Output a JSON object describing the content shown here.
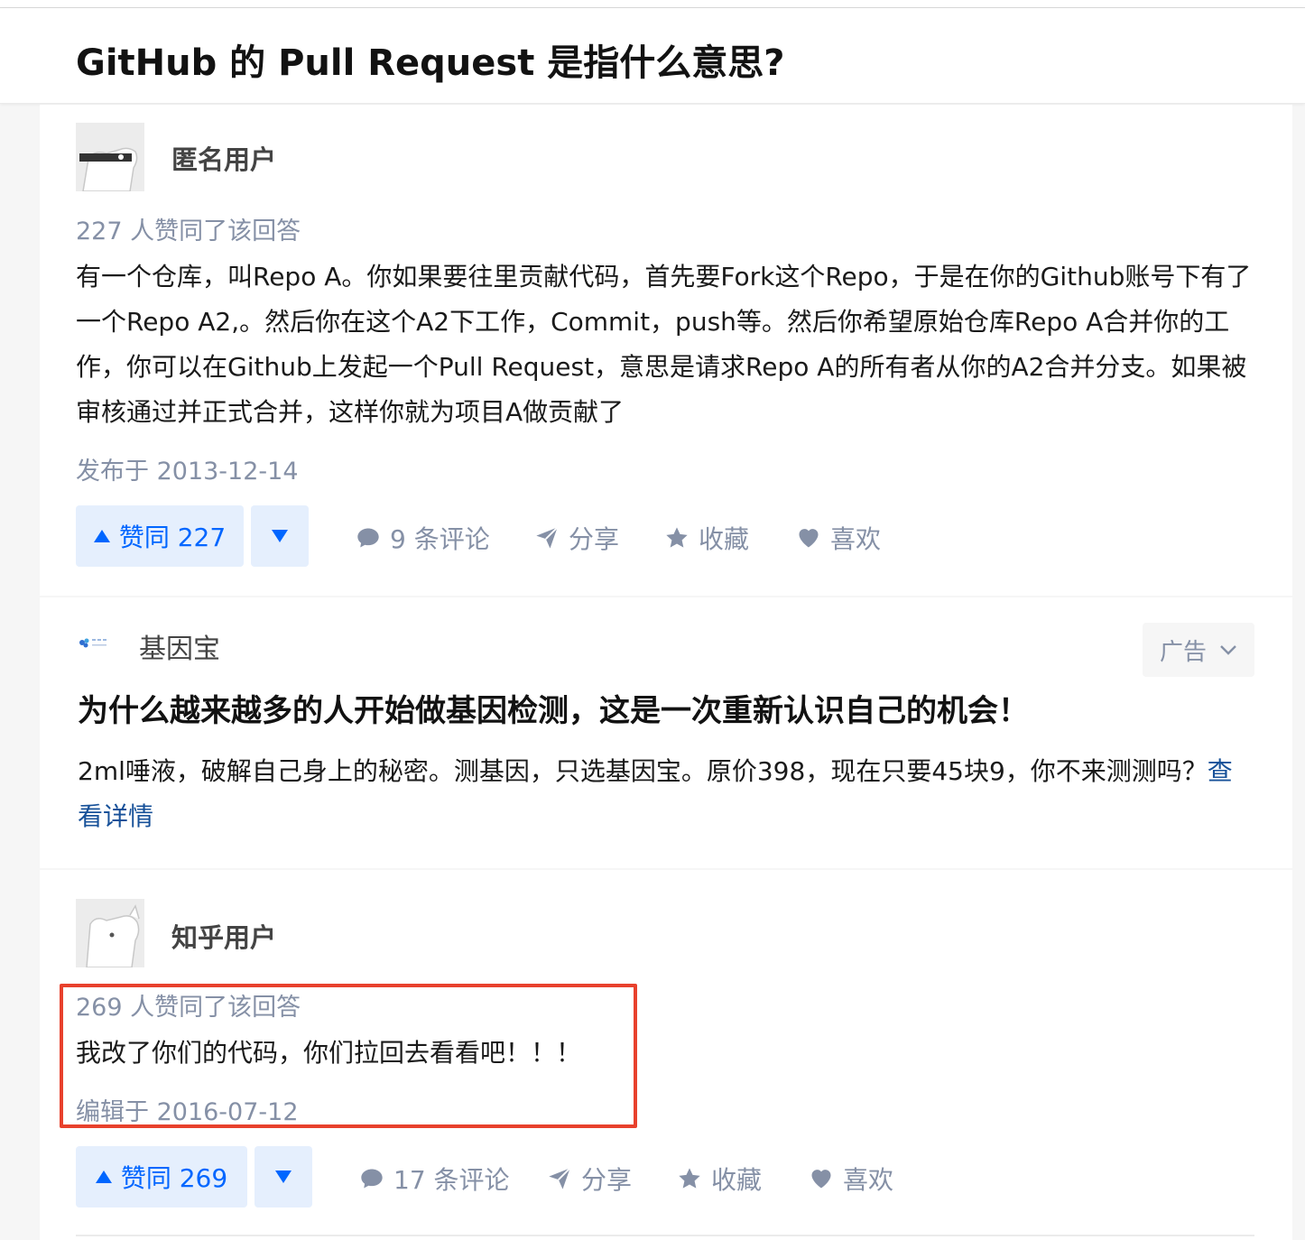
{
  "question": {
    "title": "GitHub 的 Pull Request 是指什么意思?"
  },
  "answers": [
    {
      "author": "匿名用户",
      "votes_text": "227 人赞同了该回答",
      "content": "有一个仓库，叫Repo A。你如果要往里贡献代码，首先要Fork这个Repo，于是在你的Github账号下有了一个Repo A2,。然后你在这个A2下工作，Commit，push等。然后你希望原始仓库Repo A合并你的工作，你可以在Github上发起一个Pull Request，意思是请求Repo A的所有者从你的A2合并分支。如果被审核通过并正式合并，这样你就为项目A做贡献了",
      "date": "发布于 2013-12-14",
      "upvote_label": "赞同 227",
      "comments_label": "9 条评论",
      "share_label": "分享",
      "collect_label": "收藏",
      "like_label": "喜欢"
    },
    {
      "author": "知乎用户",
      "votes_text": "269 人赞同了该回答",
      "content": "我改了你们的代码，你们拉回去看看吧！！！",
      "date": "编辑于 2016-07-12",
      "upvote_label": "赞同 269",
      "comments_label": "17 条评论",
      "share_label": "分享",
      "collect_label": "收藏",
      "like_label": "喜欢"
    }
  ],
  "ad": {
    "source": "基因宝",
    "tag": "广告",
    "title": "为什么越来越多的人开始做基因检测，这是一次重新认识自己的机会！",
    "text": "2ml唾液，破解自己身上的秘密。测基因，只选基因宝。原价398，现在只要45块9，你不来测测吗？",
    "link": "查看详情"
  },
  "colors": {
    "accent": "#0066ff",
    "upvote_bg": "#e5effd",
    "meta_gray": "#8590a6",
    "link": "#175199",
    "highlight": "#e8412c"
  },
  "icons": [
    "caret-up-icon",
    "caret-down-icon",
    "comment-icon",
    "share-icon",
    "star-icon",
    "heart-icon",
    "chevron-down-icon",
    "genebao-logo"
  ]
}
